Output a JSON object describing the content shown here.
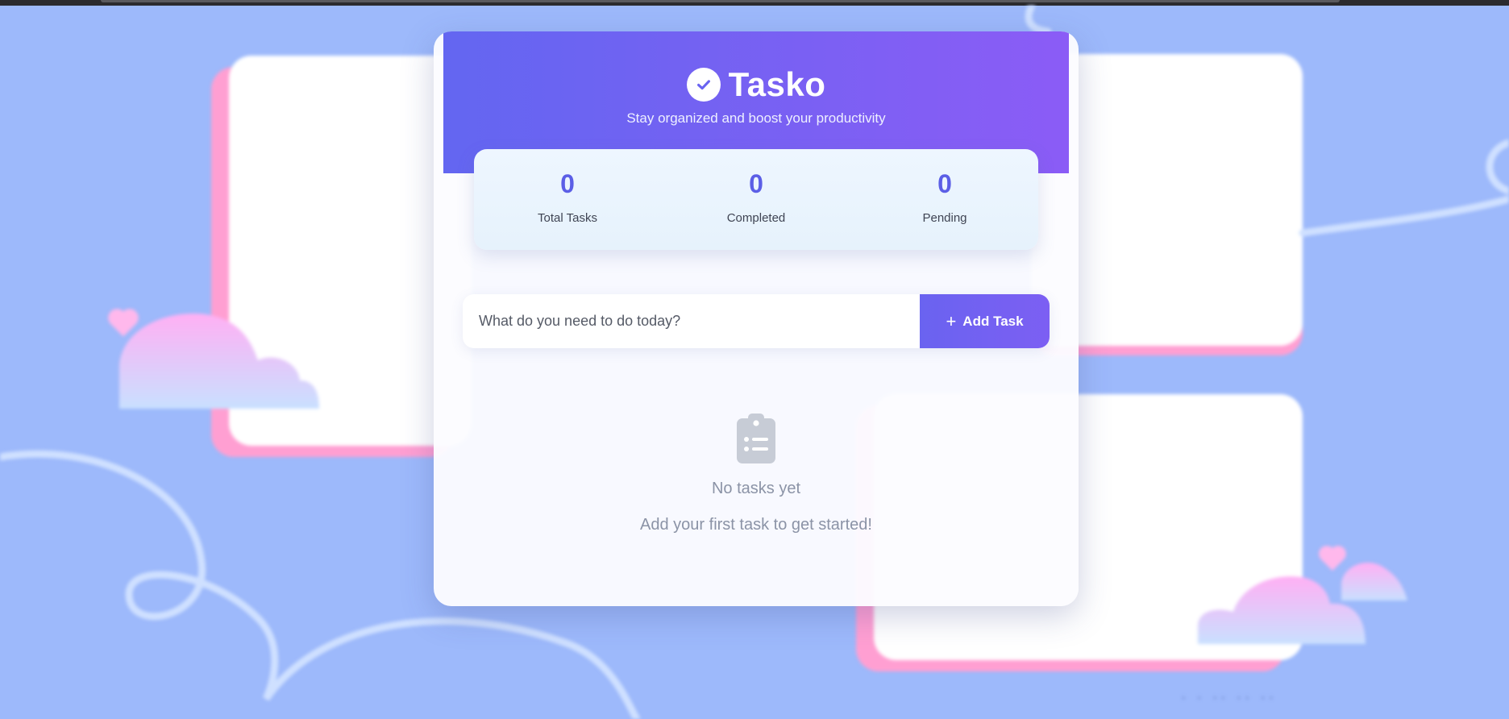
{
  "app": {
    "title": "Tasko",
    "tagline": "Stay organized and boost your productivity"
  },
  "stats": [
    {
      "value": "0",
      "label": "Total Tasks"
    },
    {
      "value": "0",
      "label": "Completed"
    },
    {
      "value": "0",
      "label": "Pending"
    }
  ],
  "task_form": {
    "input_value": "",
    "placeholder": "What do you need to do today?",
    "add_button_label": "Add Task"
  },
  "empty_state": {
    "icon": "clipboard-list-icon",
    "title": "No tasks yet",
    "subtitle": "Add your first task to get started!"
  },
  "colors": {
    "background": "#9db9fb",
    "header_start": "#6366f1",
    "header_end": "#8b5cf6",
    "stat_value": "#5b5ee6",
    "accent_pink": "#ff9fd2"
  }
}
